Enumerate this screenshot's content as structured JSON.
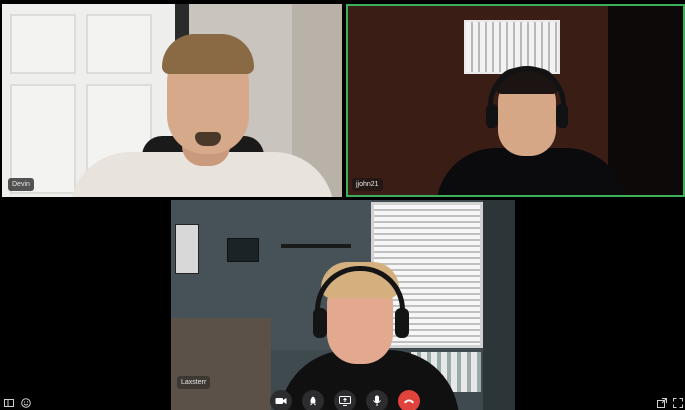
{
  "participants": [
    {
      "name": "Devin"
    },
    {
      "name": "jjohn21",
      "speaking": true
    },
    {
      "name": "Laxsterr"
    }
  ],
  "colors": {
    "active_speaker_border": "#3fb05a",
    "end_call": "#e0433b",
    "control_bg": "#2c2c2e"
  },
  "controls": [
    {
      "icon": "camera-off-icon"
    },
    {
      "icon": "rocket-icon"
    },
    {
      "icon": "screen-share-icon"
    },
    {
      "icon": "microphone-icon"
    },
    {
      "icon": "end-call-icon"
    }
  ],
  "corner_icons": {
    "bottom_left": [
      "layout-icon",
      "emoji-icon"
    ],
    "bottom_right": [
      "popout-icon",
      "fullscreen-icon"
    ]
  }
}
